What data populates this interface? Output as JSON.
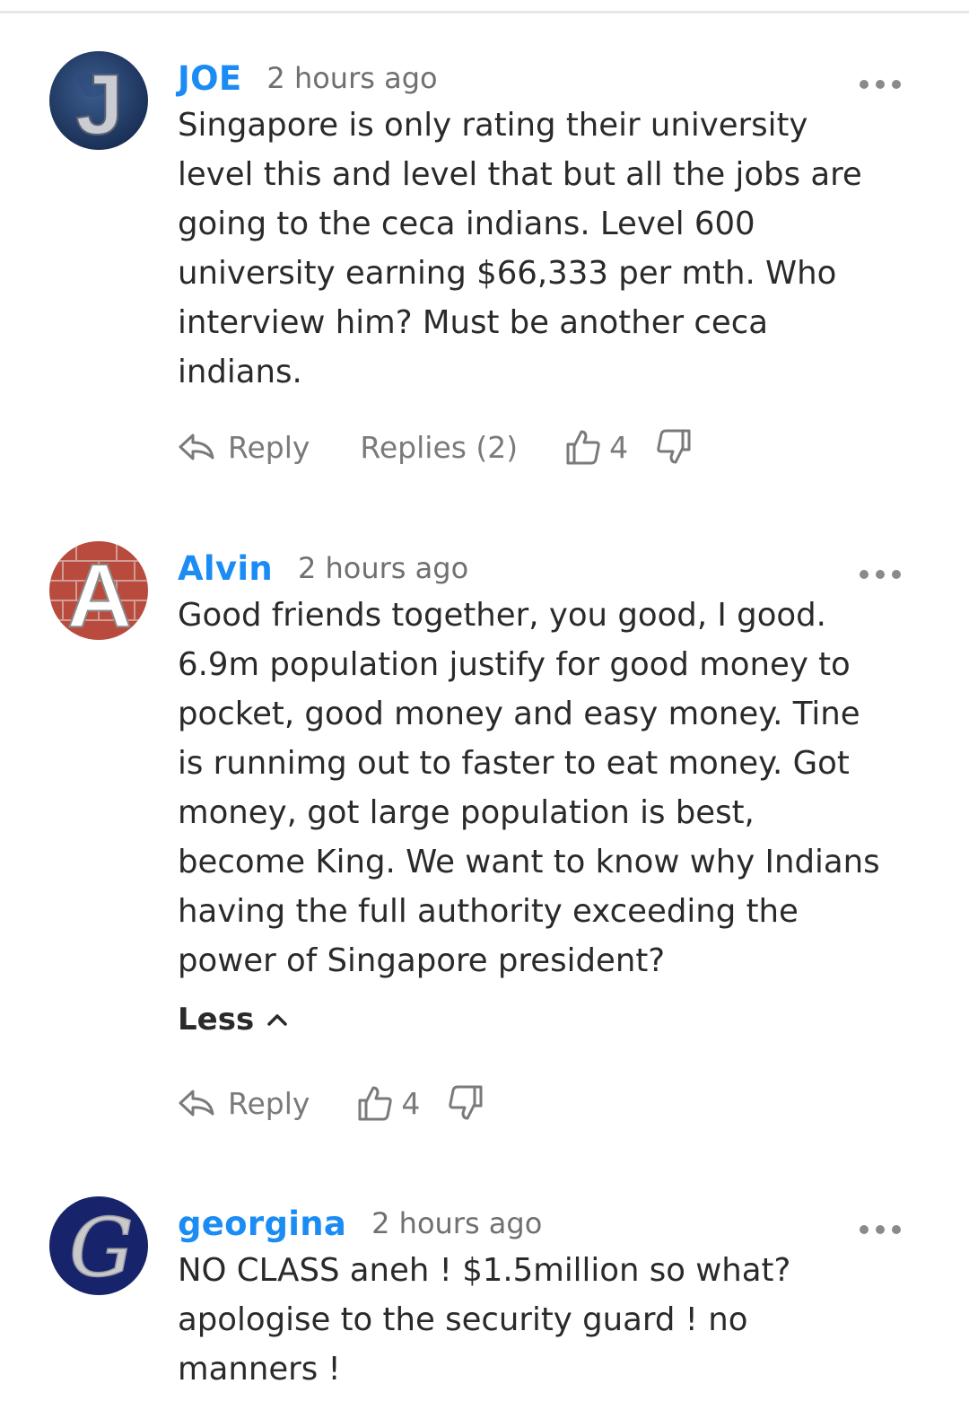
{
  "comments": [
    {
      "author": "JOE",
      "time": "2 hours ago",
      "avatar_letter": "J",
      "text": "Singapore is only rating their university\nlevel this and level that but all the jobs are\ngoing to the ceca indians. Level 600\nuniversity earning $66,333 per mth. Who\ninterview him? Must be another ceca\nindians.",
      "reply_label": "Reply",
      "replies_label": "Replies (2)",
      "likes": "4"
    },
    {
      "author": "Alvin",
      "time": "2 hours ago",
      "avatar_letter": "A",
      "text": "Good friends together, you good, I good.\n6.9m population justify for good money to\npocket, good money and easy money. Tine\nis runnimg out to faster to eat money. Got\nmoney, got large population is best,\nbecome King. We want to know why Indians\nhaving the full authority exceeding the\npower of Singapore president?",
      "less_label": "Less",
      "reply_label": "Reply",
      "likes": "4"
    },
    {
      "author": "georgina",
      "time": "2 hours ago",
      "avatar_letter": "G",
      "text": "NO CLASS aneh ! $1.5million so what?\napologise to the security guard ! no\nmanners !"
    }
  ],
  "colors": {
    "author": "#1b8cf3",
    "meta": "#707070",
    "body": "#2a2a2a"
  },
  "icons": [
    "more-icon",
    "reply-icon",
    "thumbs-up-icon",
    "thumbs-down-icon",
    "chevron-up-icon"
  ]
}
